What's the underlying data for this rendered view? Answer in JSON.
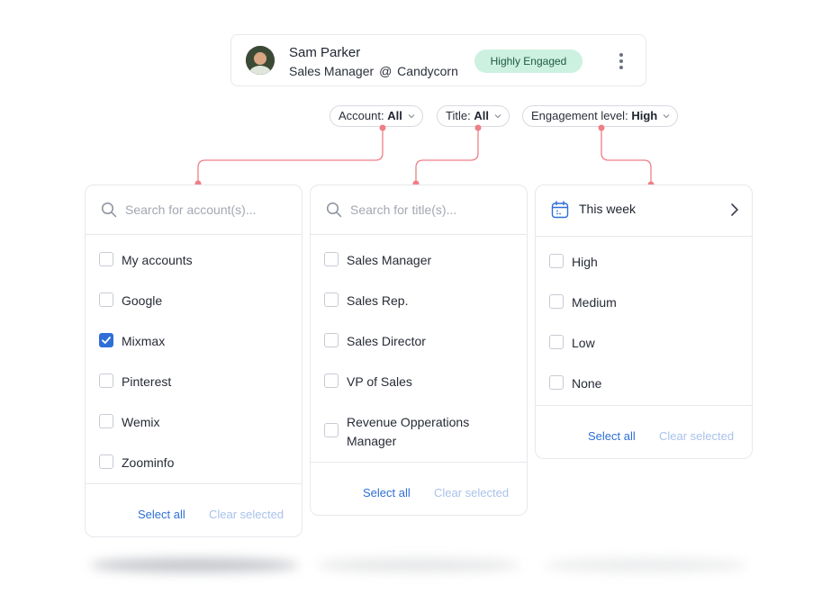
{
  "profile": {
    "name": "Sam Parker",
    "role": "Sales Manager",
    "at": "@",
    "company": "Candycorn",
    "badge": "Highly Engaged",
    "badge_color": "#cdf1e0"
  },
  "filters": [
    {
      "label": "Account:",
      "value": "All"
    },
    {
      "label": "Title:",
      "value": "All"
    },
    {
      "label": "Engagement level:",
      "value": "High"
    }
  ],
  "account_panel": {
    "search_placeholder": "Search for account(s)...",
    "items": [
      {
        "label": "My accounts",
        "checked": false
      },
      {
        "label": "Google",
        "checked": false
      },
      {
        "label": "Mixmax",
        "checked": true
      },
      {
        "label": "Pinterest",
        "checked": false
      },
      {
        "label": "Wemix",
        "checked": false
      },
      {
        "label": "Zoominfo",
        "checked": false
      }
    ],
    "select_all": "Select all",
    "clear_selected": "Clear selected"
  },
  "title_panel": {
    "search_placeholder": "Search for title(s)...",
    "items": [
      {
        "label": "Sales Manager",
        "checked": false
      },
      {
        "label": "Sales Rep.",
        "checked": false
      },
      {
        "label": "Sales Director",
        "checked": false
      },
      {
        "label": "VP of Sales",
        "checked": false
      },
      {
        "label": "Revenue Opperations Manager",
        "checked": false
      }
    ],
    "select_all": "Select all",
    "clear_selected": "Clear selected"
  },
  "engagement_panel": {
    "date_range": "This week",
    "items": [
      {
        "label": "High",
        "checked": false
      },
      {
        "label": "Medium",
        "checked": false
      },
      {
        "label": "Low",
        "checked": false
      },
      {
        "label": "None",
        "checked": false
      }
    ],
    "select_all": "Select all",
    "clear_selected": "Clear selected"
  },
  "colors": {
    "accent": "#2f6fd6",
    "connector": "#ef7f86",
    "muted_link": "#a9c2ea"
  }
}
